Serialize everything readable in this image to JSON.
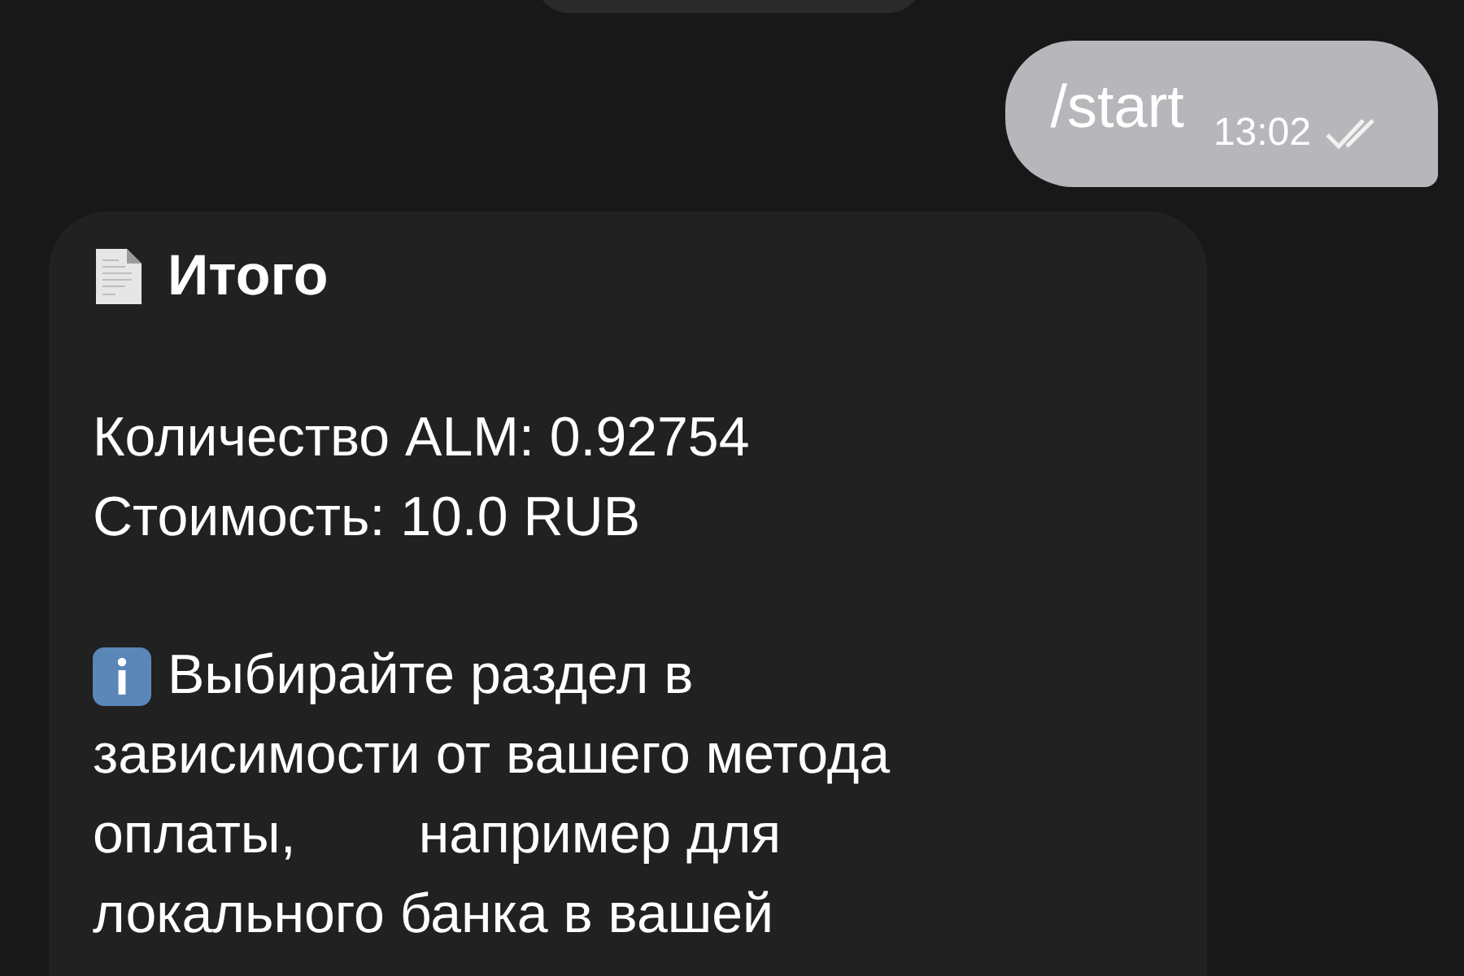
{
  "outgoing": {
    "text": "/start",
    "time": "13:02",
    "read": true
  },
  "incoming": {
    "title": "Итого",
    "details": [
      "Количество ALM: 0.92754",
      "Стоимость: 10.0 RUB"
    ],
    "note": [
      "Выбирайте раздел в",
      "зависимости от вашего метода",
      "оплаты,        например для",
      "локального банка в вашей"
    ]
  }
}
